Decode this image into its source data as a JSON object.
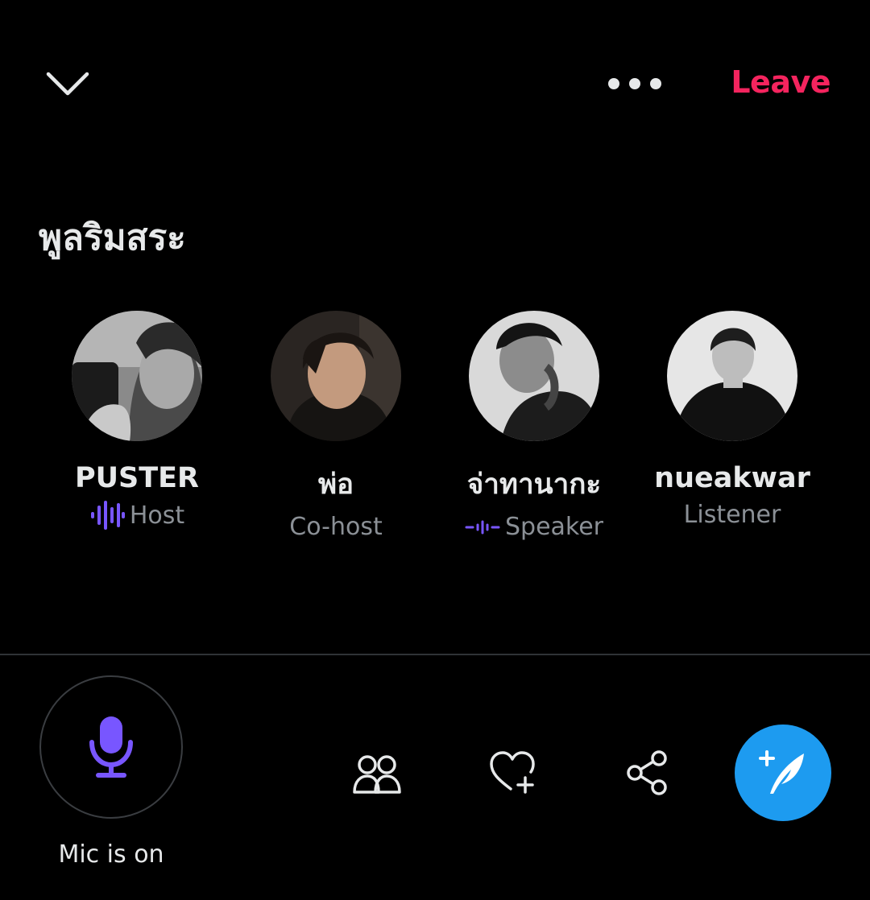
{
  "header": {
    "leave_label": "Leave",
    "collapse_icon": "chevron-down-icon",
    "more_icon": "more-horizontal-icon"
  },
  "space": {
    "title": "พูลริมสระ"
  },
  "participants": [
    {
      "name": "PUSTER",
      "role": "Host",
      "indicator": "speaking-waveform-icon"
    },
    {
      "name": "พ่อ",
      "role": "Co-host",
      "indicator": ""
    },
    {
      "name": "จ่าทานากะ",
      "role": "Speaker",
      "indicator": "speaking-waveform-icon"
    },
    {
      "name": "nueakwar",
      "role": "Listener",
      "indicator": ""
    }
  ],
  "controls": {
    "mic_label": "Mic is on",
    "mic_icon": "microphone-icon",
    "people_icon": "people-icon",
    "react_icon": "heart-plus-icon",
    "share_icon": "share-icon",
    "compose_icon": "compose-feather-icon"
  },
  "colors": {
    "background": "#000000",
    "leave": "#f4245e",
    "accent_purple": "#7856ff",
    "compose_blue": "#1d9bf0",
    "secondary_text": "#8b9096"
  }
}
